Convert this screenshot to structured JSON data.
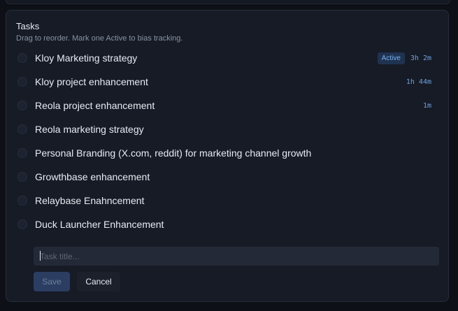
{
  "panel": {
    "title": "Tasks",
    "subtitle": "Drag to reorder. Mark one Active to bias tracking."
  },
  "tasks": [
    {
      "label": "Kloy Marketing strategy",
      "badge": "Active",
      "time": "3h 2m"
    },
    {
      "label": "Kloy project enhancement",
      "badge": "",
      "time": "1h 44m"
    },
    {
      "label": "Reola project enhancement",
      "badge": "",
      "time": "1m"
    },
    {
      "label": "Reola marketing strategy",
      "badge": "",
      "time": ""
    },
    {
      "label": "Personal Branding (X.com, reddit) for marketing channel growth",
      "badge": "",
      "time": ""
    },
    {
      "label": "Growthbase enhancement",
      "badge": "",
      "time": ""
    },
    {
      "label": "Relaybase Enahncement",
      "badge": "",
      "time": ""
    },
    {
      "label": "Duck Launcher Enhancement",
      "badge": "",
      "time": ""
    }
  ],
  "form": {
    "placeholder": "Task title...",
    "value": "",
    "save_label": "Save",
    "cancel_label": "Cancel"
  },
  "colors": {
    "background": "#0d1117",
    "panel": "#161b26",
    "accent": "#6fa0e0",
    "badge_bg": "#1f3350"
  }
}
